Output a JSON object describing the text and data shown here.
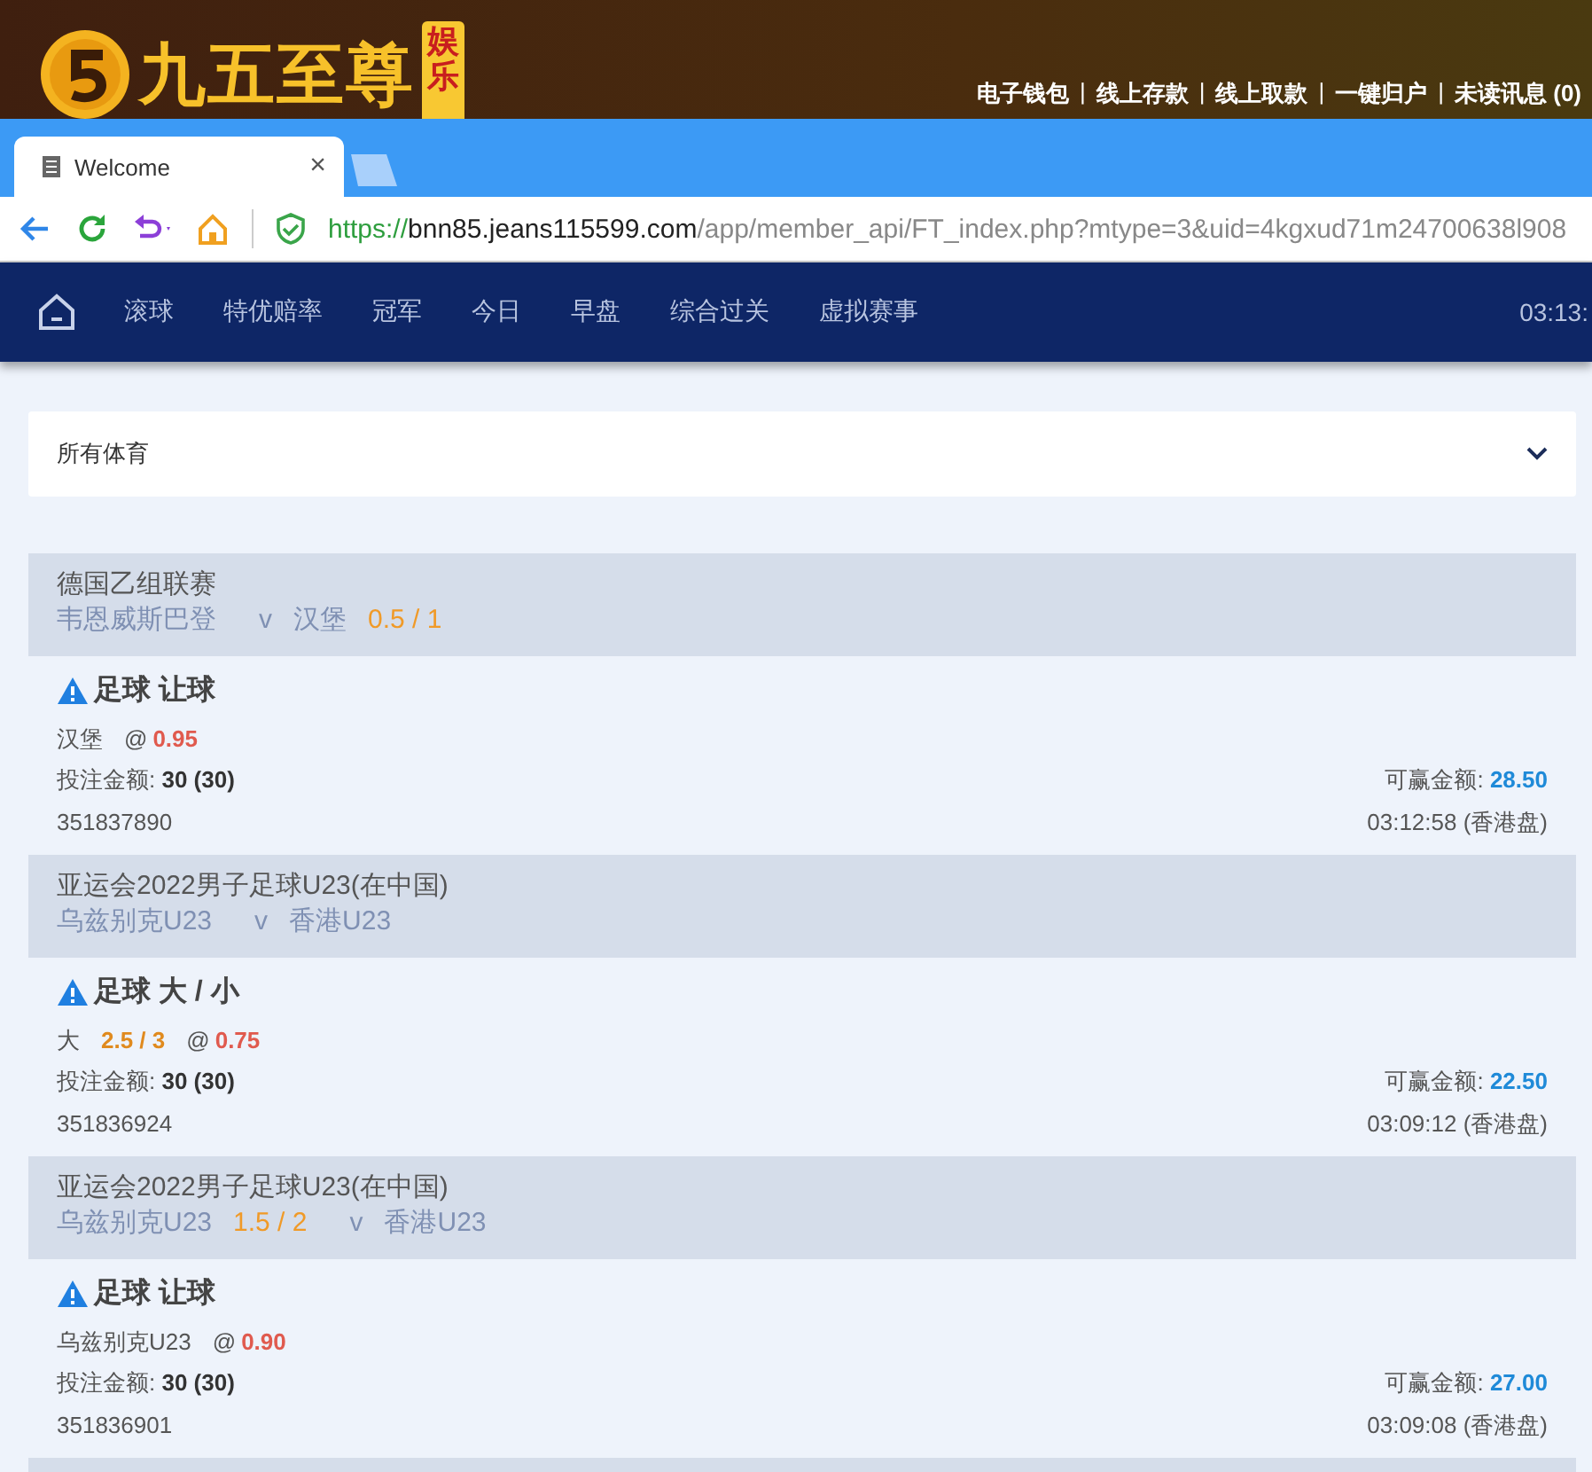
{
  "site_header": {
    "logo_text": "九五至尊",
    "logo_badge": "娱乐",
    "links": [
      "电子钱包",
      "线上存款",
      "线上取款",
      "一键归户",
      "未读讯息 (0)"
    ],
    "separator": "|"
  },
  "browser": {
    "tab": {
      "title": "Welcome",
      "close": "×"
    },
    "address": {
      "scheme": "https://",
      "host": "bnn85.jeans115599.com",
      "path": "/app/member_api/FT_index.php?mtype=3&uid=4kgxud71m24700638l908"
    }
  },
  "nav": {
    "items": [
      "滚球",
      "特优赔率",
      "冠军",
      "今日",
      "早盘",
      "综合过关",
      "虚拟赛事"
    ],
    "time": "03:13:"
  },
  "sport_filter": {
    "value": "所有体育"
  },
  "bets": [
    {
      "league": "德国乙组联赛",
      "matchup": [
        {
          "kind": "team",
          "text": "韦恩威斯巴登"
        },
        {
          "kind": "versus",
          "text": "v"
        },
        {
          "kind": "team",
          "text": "汉堡"
        },
        {
          "kind": "handicap",
          "text": "0.5 / 1"
        }
      ],
      "market": "足球 让球",
      "pick": {
        "selection": "汉堡",
        "at": "@",
        "odds": "0.95"
      },
      "stake": "投注金额: **30 (30)**",
      "win": "可赢金额: **28.50**",
      "ticket": "351837890",
      "time": "03:12:58 (香港盘)"
    },
    {
      "league": "亚运会2022男子足球U23(在中国)",
      "matchup": [
        {
          "kind": "team",
          "text": "乌兹别克U23"
        },
        {
          "kind": "versus",
          "text": "v"
        },
        {
          "kind": "team",
          "text": "香港U23"
        }
      ],
      "market": "足球 大 / 小",
      "pick": {
        "selection": "大",
        "line": "2.5 / 3",
        "at": "@",
        "odds": "0.75"
      },
      "stake": "投注金额: **30 (30)**",
      "win": "可赢金额: **22.50**",
      "ticket": "351836924",
      "time": "03:09:12 (香港盘)"
    },
    {
      "league": "亚运会2022男子足球U23(在中国)",
      "matchup": [
        {
          "kind": "team",
          "text": "乌兹别克U23"
        },
        {
          "kind": "handicap",
          "text": "1.5 / 2"
        },
        {
          "kind": "versus",
          "text": "v"
        },
        {
          "kind": "team",
          "text": "香港U23"
        }
      ],
      "market": "足球 让球",
      "pick": {
        "selection": "乌兹别克U23",
        "at": "@",
        "odds": "0.90"
      },
      "stake": "投注金额: **30 (30)**",
      "win": "可赢金额: **27.00**",
      "ticket": "351836901",
      "time": "03:09:08 (香港盘)"
    }
  ]
}
